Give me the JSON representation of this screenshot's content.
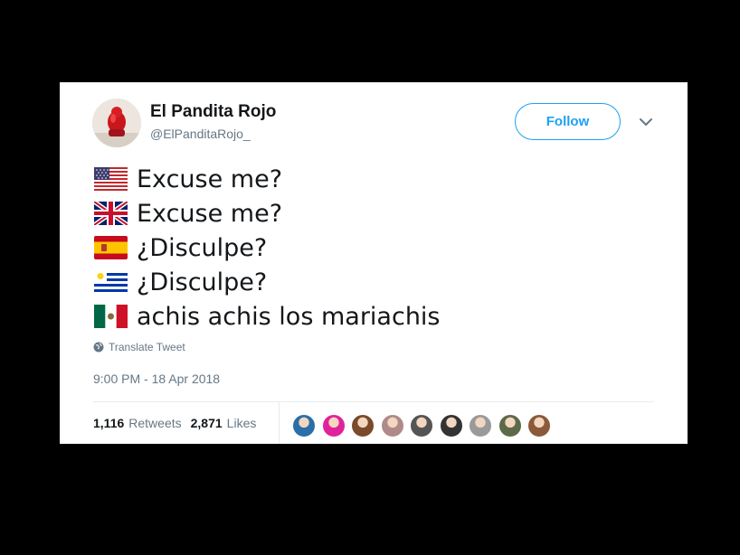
{
  "author": {
    "name": "El Pandita Rojo",
    "handle": "@ElPanditaRojo_",
    "avatar_icon": "red-panda-figure-icon"
  },
  "follow_label": "Follow",
  "tweet_lines": [
    {
      "flag": "us-flag-icon",
      "text": "Excuse me?"
    },
    {
      "flag": "uk-flag-icon",
      "text": "Excuse me?"
    },
    {
      "flag": "spain-flag-icon",
      "text": "¿Disculpe?"
    },
    {
      "flag": "uruguay-flag-icon",
      "text": "¿Disculpe?"
    },
    {
      "flag": "mexico-flag-icon",
      "text": "achis achis los mariachis"
    }
  ],
  "translate_label": "Translate Tweet",
  "timestamp": "9:00 PM - 18 Apr 2018",
  "stats": {
    "retweets_count": "1,116",
    "retweets_label": "Retweets",
    "likes_count": "2,871",
    "likes_label": "Likes"
  },
  "colors": {
    "accent": "#1da1f2",
    "secondary_text": "#657786",
    "primary_text": "#14171a"
  },
  "likers": [
    {
      "color": "#2a6fa8"
    },
    {
      "color": "#e0239a"
    },
    {
      "color": "#7a4a2a"
    },
    {
      "color": "#b08a8a"
    },
    {
      "color": "#555555"
    },
    {
      "color": "#333333"
    },
    {
      "color": "#9a9a9a"
    },
    {
      "color": "#5c6a4a"
    },
    {
      "color": "#8a5a3a"
    }
  ]
}
